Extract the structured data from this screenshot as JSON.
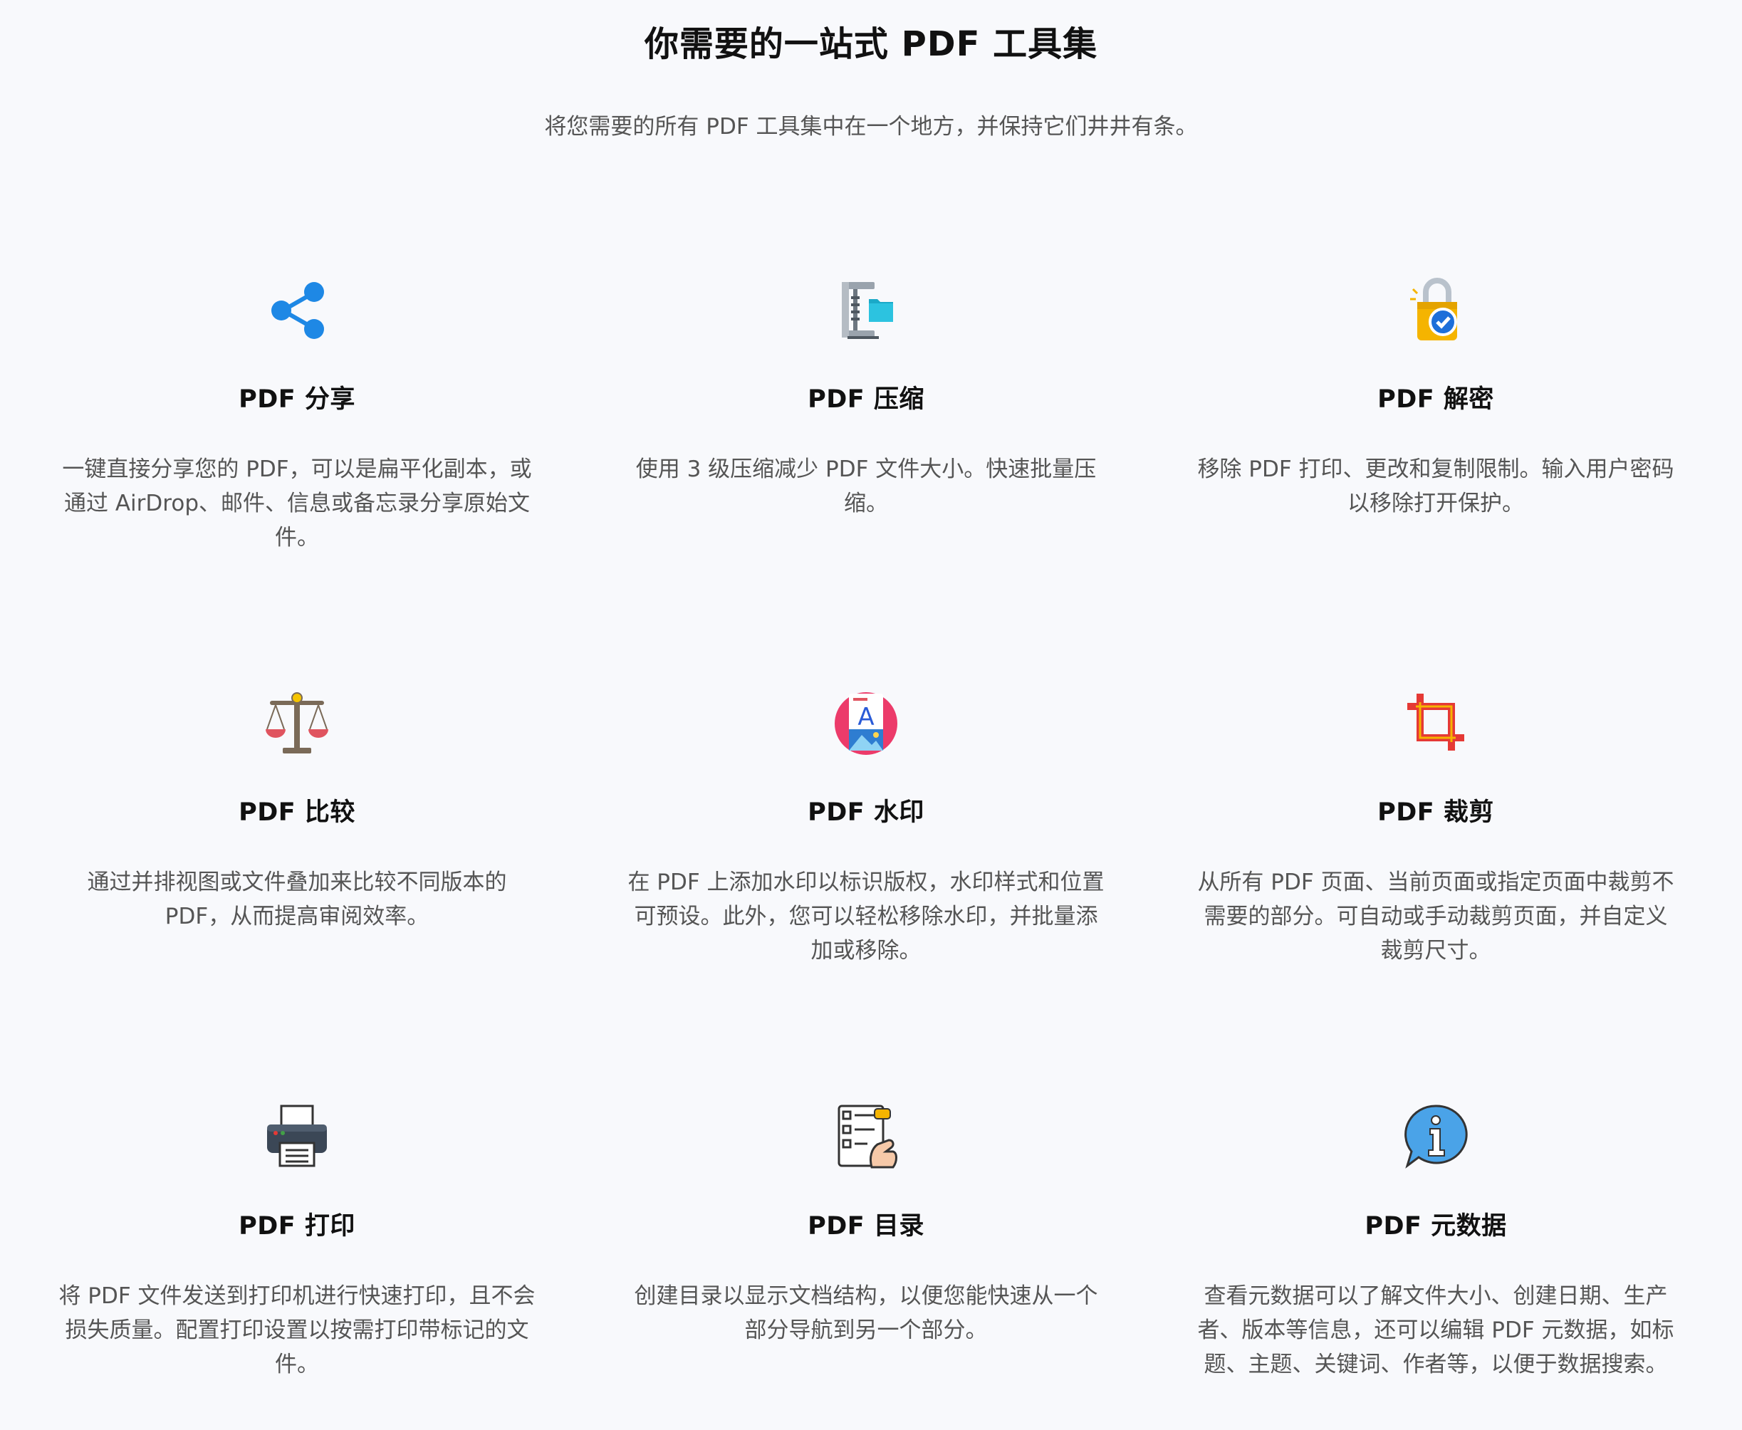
{
  "header": {
    "title": "你需要的一站式 PDF 工具集",
    "subtitle": "将您需要的所有 PDF 工具集中在一个地方，并保持它们井井有条。"
  },
  "features": [
    {
      "title": "PDF 分享",
      "icon": "share-icon",
      "description": "一键直接分享您的 PDF，可以是扁平化副本，或通过 AirDrop、邮件、信息或备忘录分享原始文件。"
    },
    {
      "title": "PDF 压缩",
      "icon": "compress-clamp-icon",
      "description": "使用 3 级压缩减少 PDF 文件大小。快速批量压缩。"
    },
    {
      "title": "PDF 解密",
      "icon": "unlock-padlock-icon",
      "description": "移除 PDF 打印、更改和复制限制。输入用户密码以移除打开保护。"
    },
    {
      "title": "PDF 比较",
      "icon": "balance-scale-icon",
      "description": "通过并排视图或文件叠加来比较不同版本的 PDF，从而提高审阅效率。"
    },
    {
      "title": "PDF 水印",
      "icon": "watermark-document-icon",
      "description": "在 PDF 上添加水印以标识版权，水印样式和位置可预设。此外，您可以轻松移除水印，并批量添加或移除。"
    },
    {
      "title": "PDF 裁剪",
      "icon": "crop-icon",
      "description": "从所有 PDF 页面、当前页面或指定页面中裁剪不需要的部分。可自动或手动裁剪页面，并自定义裁剪尺寸。"
    },
    {
      "title": "PDF 打印",
      "icon": "printer-icon",
      "description": "将 PDF 文件发送到打印机进行快速打印，且不会损失质量。配置打印设置以按需打印带标记的文件。"
    },
    {
      "title": "PDF 目录",
      "icon": "table-of-contents-icon",
      "description": "创建目录以显示文档结构，以便您能快速从一个部分导航到另一个部分。"
    },
    {
      "title": "PDF 元数据",
      "icon": "info-bubble-icon",
      "description": "查看元数据可以了解文件大小、创建日期、生产者、版本等信息，还可以编辑 PDF 元数据，如标题、主题、关键词、作者等，以便于数据搜索。"
    }
  ],
  "colors": {
    "background": "#f8f9fc",
    "share_blue": "#1e88e5",
    "scale_red": "#e0545f",
    "crop_red": "#e53935",
    "crop_gold": "#f5b400",
    "info_blue": "#2f8fd8"
  }
}
